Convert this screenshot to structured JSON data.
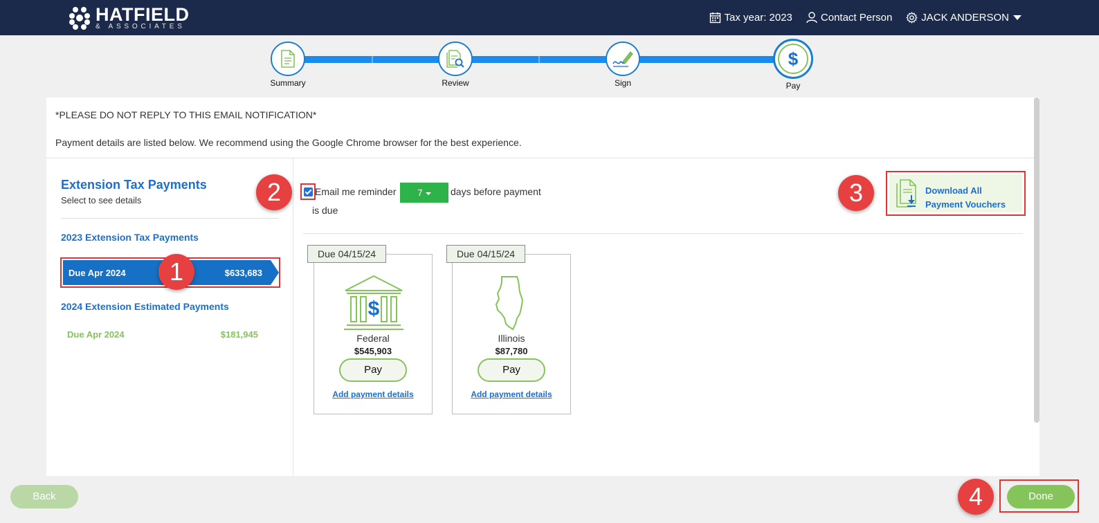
{
  "header": {
    "logo_main": "HATFIELD",
    "logo_sub": "& ASSOCIATES",
    "tax_year": "Tax year: 2023",
    "contact": "Contact Person",
    "user": "JACK ANDERSON"
  },
  "stepper": {
    "steps": [
      {
        "label": "Summary",
        "icon": "document-icon"
      },
      {
        "label": "Review",
        "icon": "review-search-icon"
      },
      {
        "label": "Sign",
        "icon": "signature-pen-icon"
      },
      {
        "label": "Pay",
        "icon": "dollar-icon",
        "glyph": "$"
      }
    ],
    "active_index": 3
  },
  "notice": {
    "line1": "*PLEASE DO NOT REPLY TO THIS EMAIL NOTIFICATION*",
    "line2": "Payment details are listed below. We recommend using the Google Chrome browser for the best experience."
  },
  "sidebar": {
    "title": "Extension Tax Payments",
    "subtitle": "Select to see details",
    "groups": [
      {
        "title": "2023 Extension Tax Payments",
        "items": [
          {
            "label": "Due Apr 2024",
            "amount": "$633,683",
            "selected": true
          }
        ]
      },
      {
        "title": "2024 Extension Estimated Payments",
        "items": [
          {
            "label": "Due Apr 2024",
            "amount": "$181,945",
            "selected": false
          }
        ]
      }
    ]
  },
  "reminder": {
    "checked": true,
    "text_before": "Email me reminder",
    "days": "7",
    "text_after": "days before payment",
    "text_after2": "is due"
  },
  "download": {
    "line1": "Download All",
    "line2": "Payment Vouchers"
  },
  "payments": [
    {
      "due": "Due 04/15/24",
      "name": "Federal",
      "amount": "$545,903",
      "pay_label": "Pay",
      "link": "Add payment details",
      "icon": "bank-dollar-icon",
      "glyph": "$"
    },
    {
      "due": "Due 04/15/24",
      "name": "Illinois",
      "amount": "$87,780",
      "pay_label": "Pay",
      "link": "Add payment details",
      "icon": "illinois-state-icon"
    }
  ],
  "markers": [
    "1",
    "2",
    "3",
    "4"
  ],
  "footer": {
    "back": "Back",
    "done": "Done"
  },
  "colors": {
    "header_bg": "#1b2a4a",
    "accent_blue": "#1570c6",
    "accent_green": "#84c45a",
    "marker_red": "#e74040"
  }
}
